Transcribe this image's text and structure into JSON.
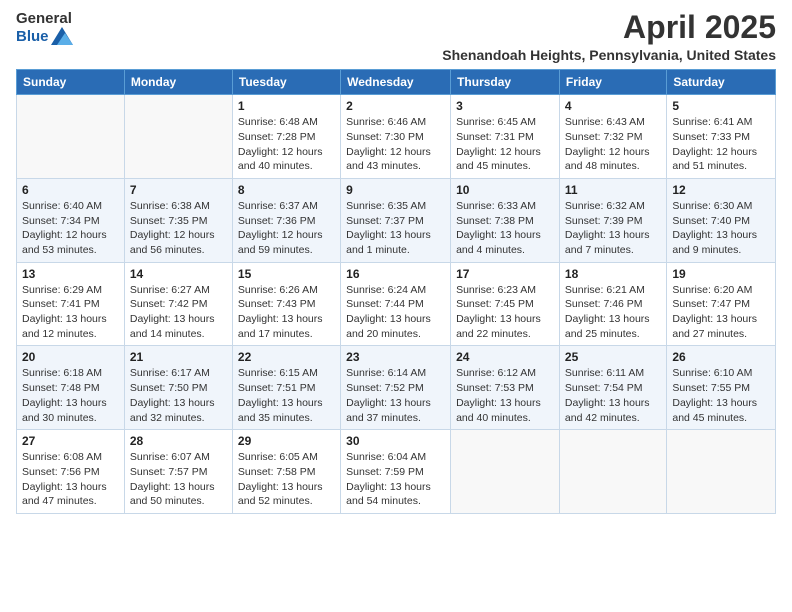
{
  "logo": {
    "general": "General",
    "blue": "Blue"
  },
  "title": "April 2025",
  "subtitle": "Shenandoah Heights, Pennsylvania, United States",
  "days_of_week": [
    "Sunday",
    "Monday",
    "Tuesday",
    "Wednesday",
    "Thursday",
    "Friday",
    "Saturday"
  ],
  "weeks": [
    [
      {
        "day": "",
        "info": ""
      },
      {
        "day": "",
        "info": ""
      },
      {
        "day": "1",
        "info": "Sunrise: 6:48 AM\nSunset: 7:28 PM\nDaylight: 12 hours and 40 minutes."
      },
      {
        "day": "2",
        "info": "Sunrise: 6:46 AM\nSunset: 7:30 PM\nDaylight: 12 hours and 43 minutes."
      },
      {
        "day": "3",
        "info": "Sunrise: 6:45 AM\nSunset: 7:31 PM\nDaylight: 12 hours and 45 minutes."
      },
      {
        "day": "4",
        "info": "Sunrise: 6:43 AM\nSunset: 7:32 PM\nDaylight: 12 hours and 48 minutes."
      },
      {
        "day": "5",
        "info": "Sunrise: 6:41 AM\nSunset: 7:33 PM\nDaylight: 12 hours and 51 minutes."
      }
    ],
    [
      {
        "day": "6",
        "info": "Sunrise: 6:40 AM\nSunset: 7:34 PM\nDaylight: 12 hours and 53 minutes."
      },
      {
        "day": "7",
        "info": "Sunrise: 6:38 AM\nSunset: 7:35 PM\nDaylight: 12 hours and 56 minutes."
      },
      {
        "day": "8",
        "info": "Sunrise: 6:37 AM\nSunset: 7:36 PM\nDaylight: 12 hours and 59 minutes."
      },
      {
        "day": "9",
        "info": "Sunrise: 6:35 AM\nSunset: 7:37 PM\nDaylight: 13 hours and 1 minute."
      },
      {
        "day": "10",
        "info": "Sunrise: 6:33 AM\nSunset: 7:38 PM\nDaylight: 13 hours and 4 minutes."
      },
      {
        "day": "11",
        "info": "Sunrise: 6:32 AM\nSunset: 7:39 PM\nDaylight: 13 hours and 7 minutes."
      },
      {
        "day": "12",
        "info": "Sunrise: 6:30 AM\nSunset: 7:40 PM\nDaylight: 13 hours and 9 minutes."
      }
    ],
    [
      {
        "day": "13",
        "info": "Sunrise: 6:29 AM\nSunset: 7:41 PM\nDaylight: 13 hours and 12 minutes."
      },
      {
        "day": "14",
        "info": "Sunrise: 6:27 AM\nSunset: 7:42 PM\nDaylight: 13 hours and 14 minutes."
      },
      {
        "day": "15",
        "info": "Sunrise: 6:26 AM\nSunset: 7:43 PM\nDaylight: 13 hours and 17 minutes."
      },
      {
        "day": "16",
        "info": "Sunrise: 6:24 AM\nSunset: 7:44 PM\nDaylight: 13 hours and 20 minutes."
      },
      {
        "day": "17",
        "info": "Sunrise: 6:23 AM\nSunset: 7:45 PM\nDaylight: 13 hours and 22 minutes."
      },
      {
        "day": "18",
        "info": "Sunrise: 6:21 AM\nSunset: 7:46 PM\nDaylight: 13 hours and 25 minutes."
      },
      {
        "day": "19",
        "info": "Sunrise: 6:20 AM\nSunset: 7:47 PM\nDaylight: 13 hours and 27 minutes."
      }
    ],
    [
      {
        "day": "20",
        "info": "Sunrise: 6:18 AM\nSunset: 7:48 PM\nDaylight: 13 hours and 30 minutes."
      },
      {
        "day": "21",
        "info": "Sunrise: 6:17 AM\nSunset: 7:50 PM\nDaylight: 13 hours and 32 minutes."
      },
      {
        "day": "22",
        "info": "Sunrise: 6:15 AM\nSunset: 7:51 PM\nDaylight: 13 hours and 35 minutes."
      },
      {
        "day": "23",
        "info": "Sunrise: 6:14 AM\nSunset: 7:52 PM\nDaylight: 13 hours and 37 minutes."
      },
      {
        "day": "24",
        "info": "Sunrise: 6:12 AM\nSunset: 7:53 PM\nDaylight: 13 hours and 40 minutes."
      },
      {
        "day": "25",
        "info": "Sunrise: 6:11 AM\nSunset: 7:54 PM\nDaylight: 13 hours and 42 minutes."
      },
      {
        "day": "26",
        "info": "Sunrise: 6:10 AM\nSunset: 7:55 PM\nDaylight: 13 hours and 45 minutes."
      }
    ],
    [
      {
        "day": "27",
        "info": "Sunrise: 6:08 AM\nSunset: 7:56 PM\nDaylight: 13 hours and 47 minutes."
      },
      {
        "day": "28",
        "info": "Sunrise: 6:07 AM\nSunset: 7:57 PM\nDaylight: 13 hours and 50 minutes."
      },
      {
        "day": "29",
        "info": "Sunrise: 6:05 AM\nSunset: 7:58 PM\nDaylight: 13 hours and 52 minutes."
      },
      {
        "day": "30",
        "info": "Sunrise: 6:04 AM\nSunset: 7:59 PM\nDaylight: 13 hours and 54 minutes."
      },
      {
        "day": "",
        "info": ""
      },
      {
        "day": "",
        "info": ""
      },
      {
        "day": "",
        "info": ""
      }
    ]
  ]
}
